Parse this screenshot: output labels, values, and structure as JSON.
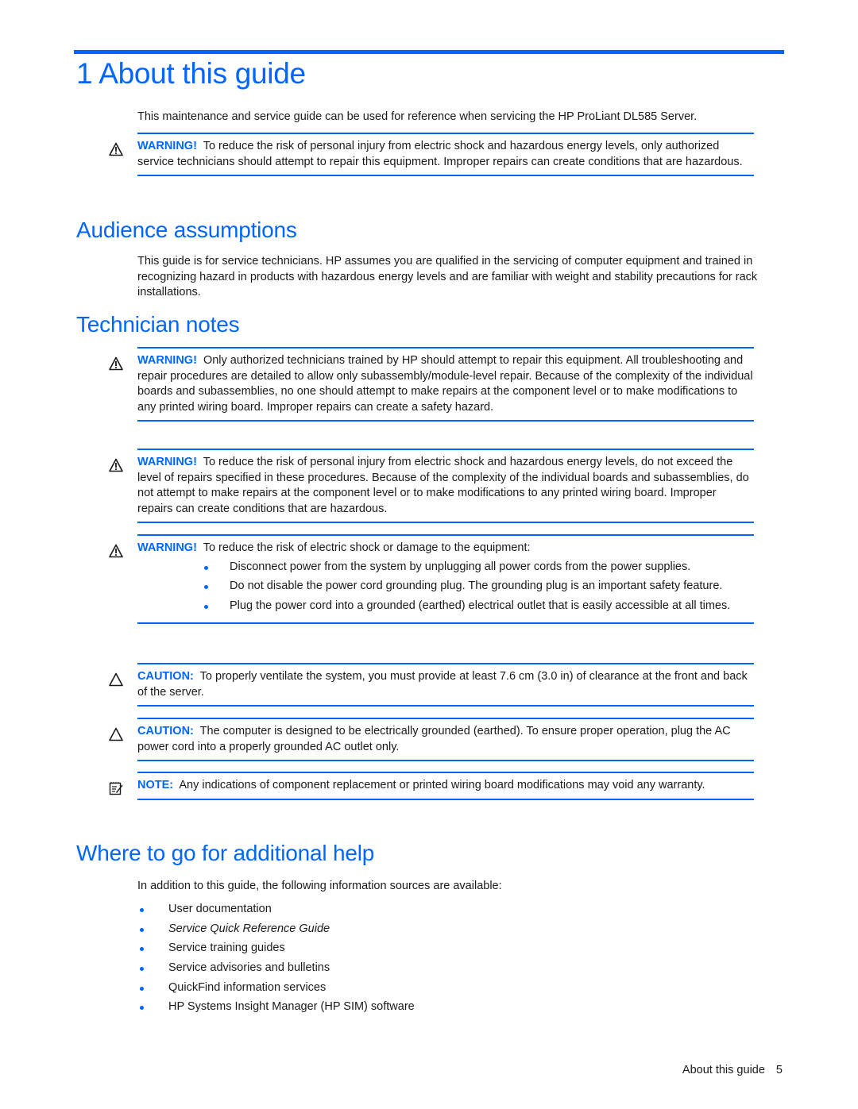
{
  "colors": {
    "accent": "#0066ff",
    "text": "#1a1a1a"
  },
  "chapter_title": "1 About this guide",
  "intro": "This maintenance and service guide can be used for reference when servicing the HP ProLiant DL585 Server.",
  "intro_warning": {
    "icon": "warning-triangle-icon",
    "label": "WARNING!",
    "text": "To reduce the risk of personal injury from electric shock and hazardous energy levels, only authorized service technicians should attempt to repair this equipment. Improper repairs can create conditions that are hazardous."
  },
  "audience": {
    "heading": "Audience assumptions",
    "text": "This guide is for service technicians. HP assumes you are qualified in the servicing of computer equipment and trained in recognizing hazard in products with hazardous energy levels and are familiar with weight and stability precautions for rack installations."
  },
  "technician": {
    "heading": "Technician notes",
    "notes": [
      {
        "icon": "warning-triangle-icon",
        "label": "WARNING!",
        "text": "Only authorized technicians trained by HP should attempt to repair this equipment. All troubleshooting and repair procedures are detailed to allow only subassembly/module-level repair. Because of the complexity of the individual boards and subassemblies, no one should attempt to make repairs at the component level or to make modifications to any printed wiring board. Improper repairs can create a safety hazard."
      },
      {
        "icon": "warning-triangle-icon",
        "label": "WARNING!",
        "text": "To reduce the risk of personal injury from electric shock and hazardous energy levels, do not exceed the level of repairs specified in these procedures. Because of the complexity of the individual boards and subassemblies, do not attempt to make repairs at the component level or to make modifications to any printed wiring board. Improper repairs can create conditions that are hazardous."
      },
      {
        "icon": "warning-triangle-icon",
        "label": "WARNING!",
        "text": "To reduce the risk of electric shock or damage to the equipment:",
        "bullets": [
          "Disconnect power from the system by unplugging all power cords from the power supplies.",
          "Do not disable the power cord grounding plug. The grounding plug is an important safety feature.",
          "Plug the power cord into a grounded (earthed) electrical outlet that is easily accessible at all times."
        ]
      },
      {
        "icon": "caution-triangle-icon",
        "label": "CAUTION:",
        "text": "To properly ventilate the system, you must provide at least 7.6 cm (3.0 in) of clearance at the front and back of the server."
      },
      {
        "icon": "caution-triangle-icon",
        "label": "CAUTION:",
        "text": "The computer is designed to be electrically grounded (earthed). To ensure proper operation, plug the AC power cord into a properly grounded AC outlet only."
      },
      {
        "icon": "note-pad-icon",
        "label": "NOTE:",
        "text": "Any indications of component replacement or printed wiring board modifications may void any warranty."
      }
    ]
  },
  "help": {
    "heading": "Where to go for additional help",
    "intro": "In addition to this guide, the following information sources are available:",
    "items": [
      "User documentation",
      "Service Quick Reference Guide",
      "Service training guides",
      "Service advisories and bulletins",
      "QuickFind information services",
      "HP Systems Insight Manager (HP SIM) software"
    ]
  },
  "footer": {
    "section": "About this guide",
    "page_number": "5"
  }
}
